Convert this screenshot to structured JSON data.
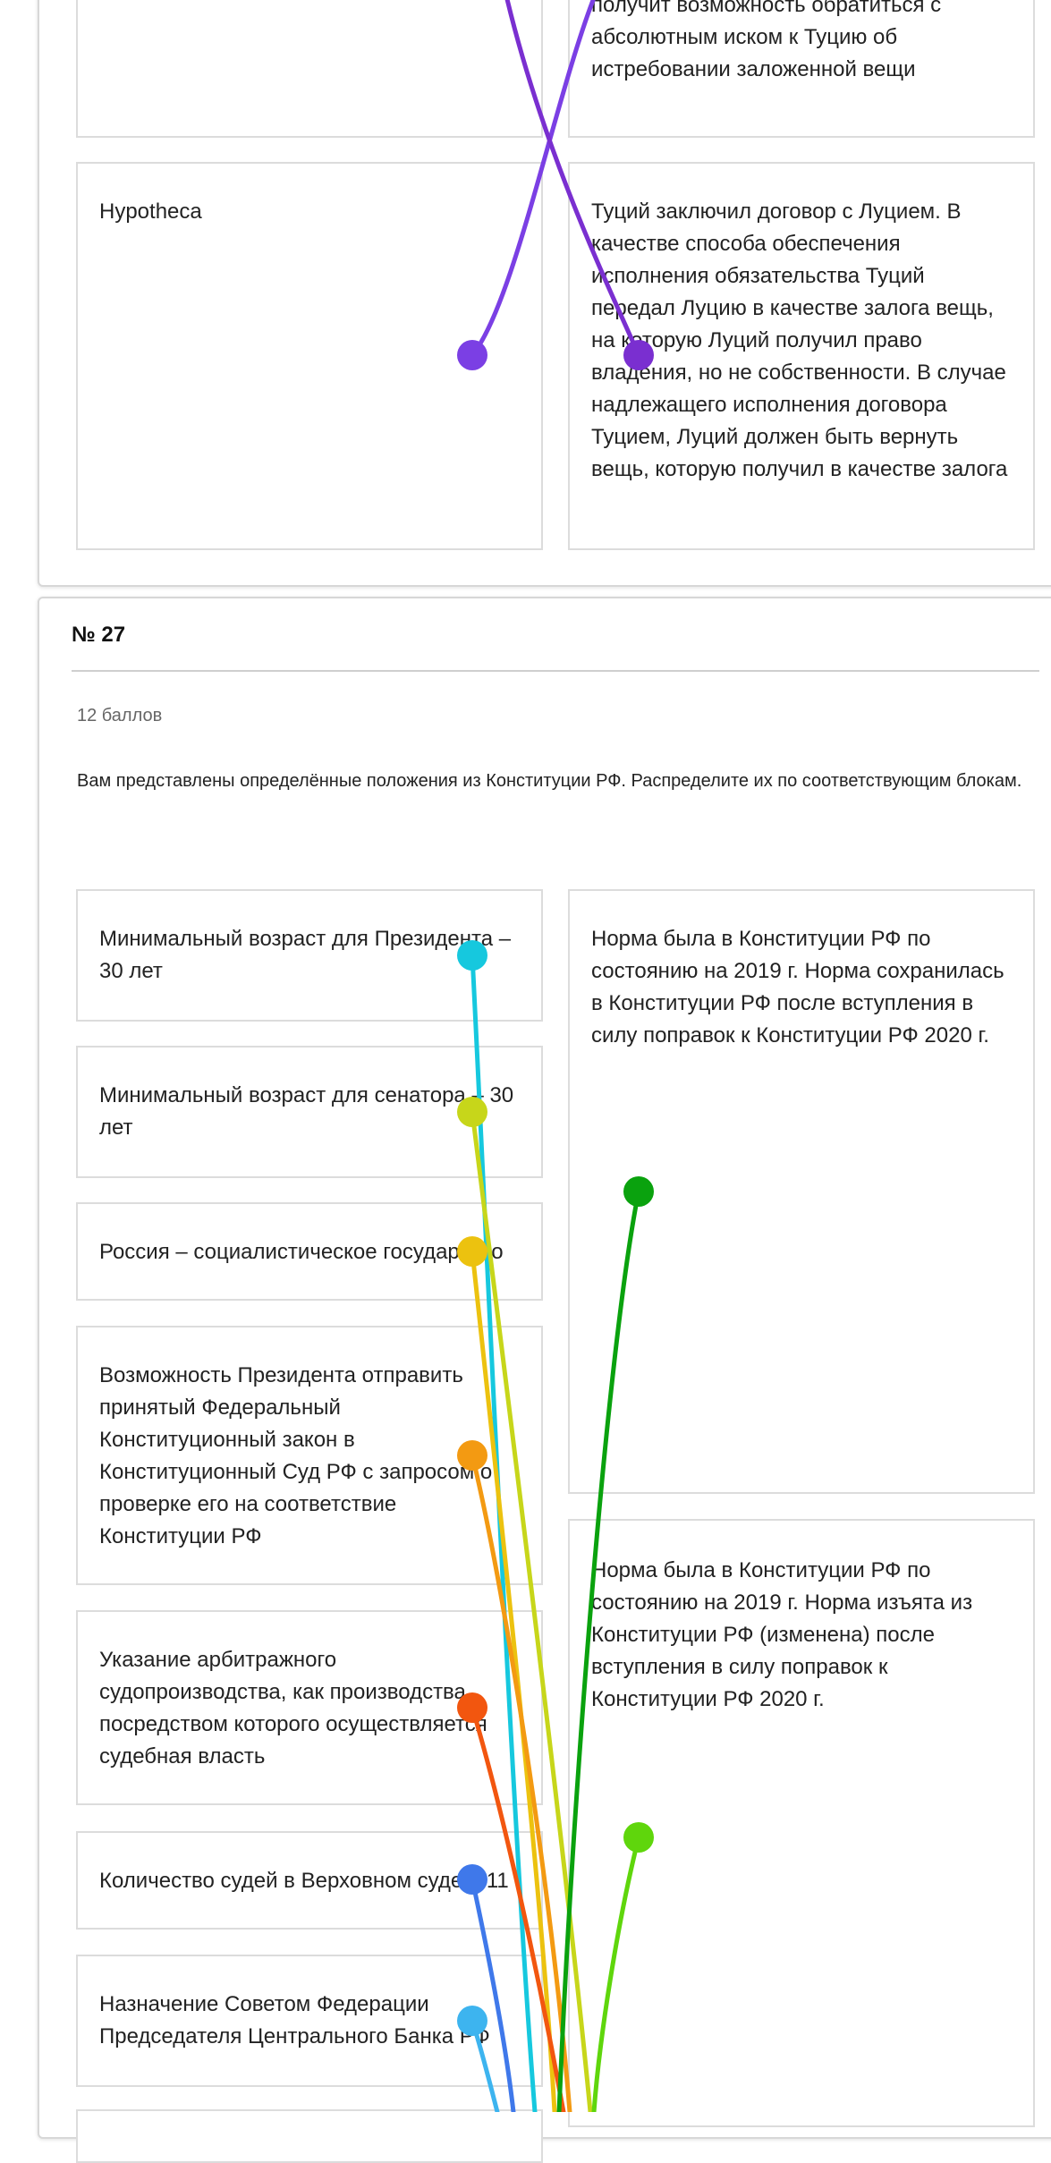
{
  "prev_question": {
    "right_item_top": {
      "text": "получит возможность обратиться с абсолютным иском к Туцию об истребовании заложенной вещи"
    },
    "left_item": {
      "text": "Hypotheca"
    },
    "right_item": {
      "text": "Туций заключил договор с Луцием. В качестве способа обеспечения исполнения обязательства Туций передал Луцию в качестве залога вещь, на которую Луций получил право владения, но не собственности. В случае надлежащего исполнения договора Туцием, Луций должен быть вернуть вещь, которую получил в качестве залога"
    }
  },
  "question": {
    "number": "№ 27",
    "points": "12 баллов",
    "instruction": "Вам представлены определённые положения из Конституции РФ. Распределите их по соответствующим блокам.",
    "left_items": [
      {
        "text": "Минимальный возраст для Президента – 30 лет"
      },
      {
        "text": "Минимальный возраст для сенатора – 30 лет"
      },
      {
        "text": "Россия – социалистическое государство"
      },
      {
        "text": "Возможность Президента отправить принятый Федеральный Конституционный закон в Конституционный Суд РФ с запросом о проверке его на соответствие Конституции РФ"
      },
      {
        "text": "Указание арбитражного судопроизводства, как производства посредством которого осуществляется судебная власть"
      },
      {
        "text": "Количество судей в Верховном суде – 11"
      },
      {
        "text": "Назначение Советом Федерации Председателя Центрального Банка РФ"
      }
    ],
    "right_blocks": [
      {
        "text": "Норма была в Конституции РФ по состоянию на 2019 г. Норма сохранилась в Конституции РФ после вступления в силу поправок к Конституции РФ 2020 г."
      },
      {
        "text": "Норма была в Конституции РФ по состоянию на 2019 г. Норма изъята из Конституции РФ (изменена) после вступления в силу поправок к Конституции РФ 2020 г."
      }
    ]
  },
  "connector_colors": {
    "prev_a": "#7b3fe4",
    "prev_b": "#7a2fd0",
    "cyan": "#16c8de",
    "lime_yellow": "#c7d61a",
    "yellow": "#ecc20f",
    "orange": "#f39a12",
    "red_orange": "#f2560f",
    "blue": "#3f78ea",
    "light_blue": "#3db4ef",
    "green": "#0aa20e",
    "light_green": "#5fd60c"
  }
}
